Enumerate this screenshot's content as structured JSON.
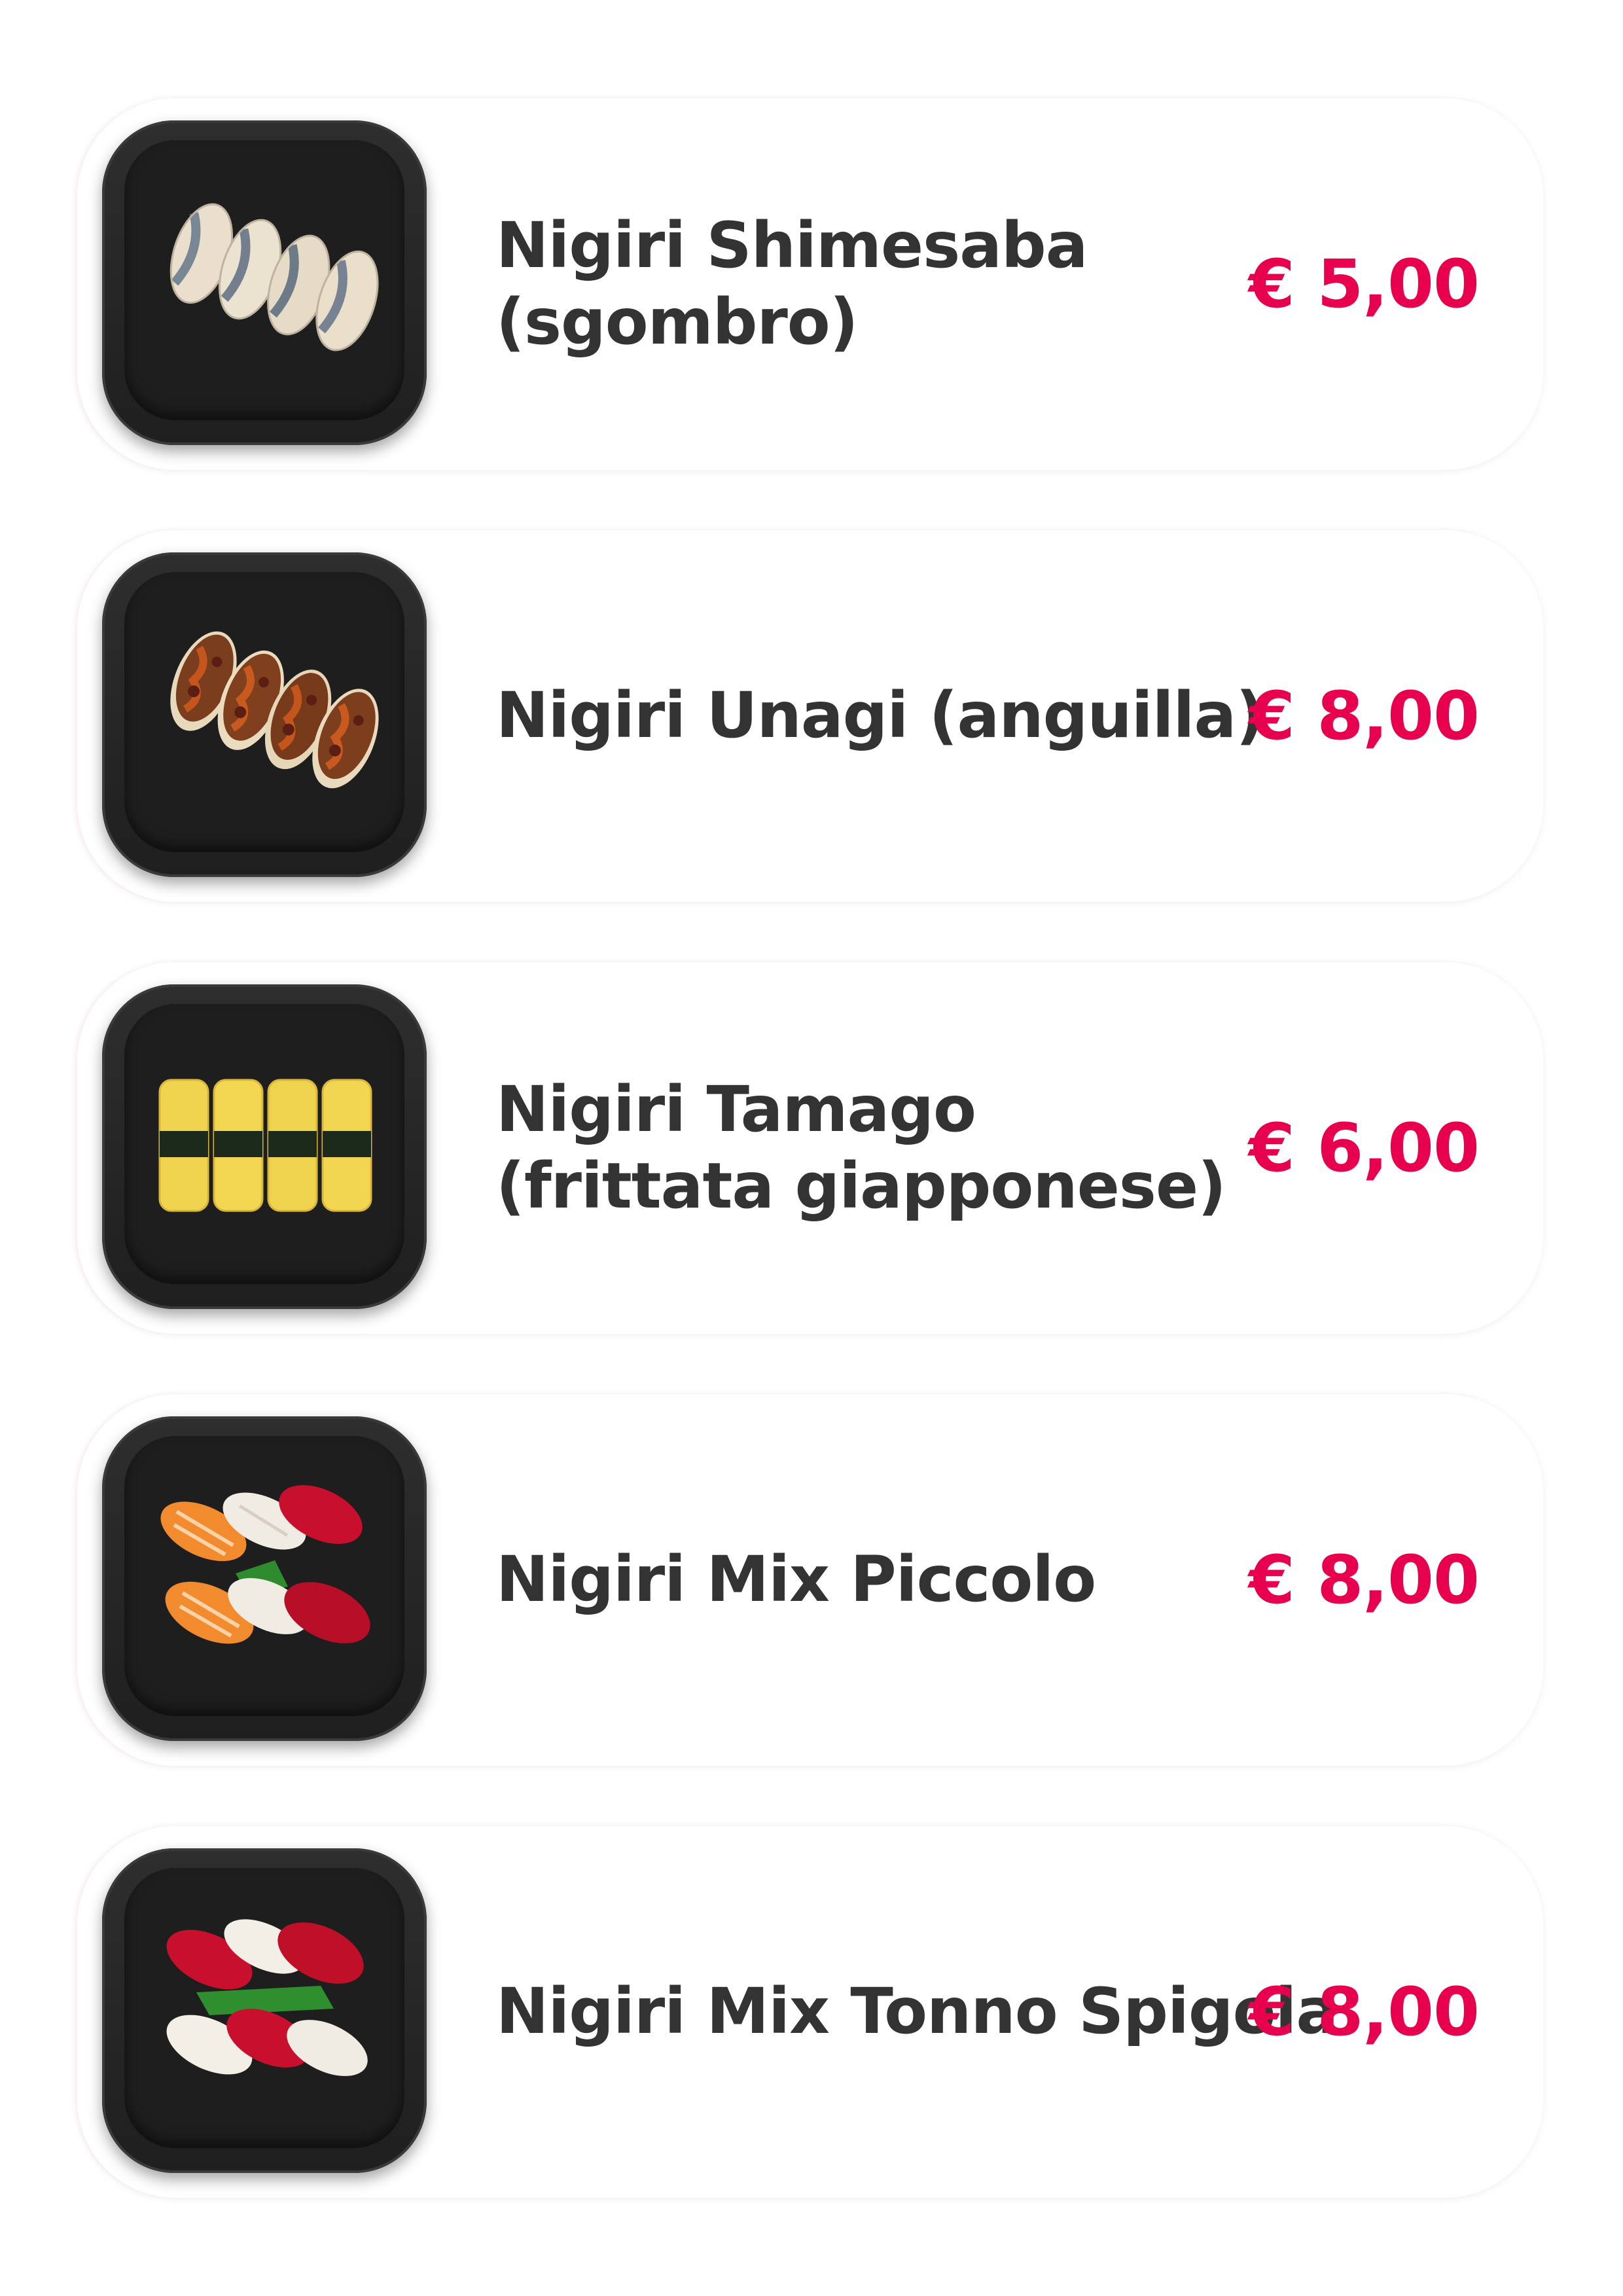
{
  "menu": {
    "accent_color": "#e6004e",
    "text_color": "#333333",
    "items": [
      {
        "name": "Nigiri Shimesaba (sgombro)",
        "line1": "Nigiri Shimesaba",
        "line2": "(sgombro)",
        "price": "€ 5,00",
        "image_icon": "mackerel-nigiri-image"
      },
      {
        "name": "Nigiri Unagi (anguilla)",
        "line1": "Nigiri Unagi (anguilla)",
        "line2": "",
        "price": "€ 8,00",
        "image_icon": "eel-nigiri-image"
      },
      {
        "name": "Nigiri Tamago (frittata giapponese)",
        "line1": "Nigiri Tamago",
        "line2": "(frittata giapponese)",
        "price": "€ 6,00",
        "image_icon": "tamago-nigiri-image"
      },
      {
        "name": "Nigiri Mix Piccolo",
        "line1": "Nigiri Mix Piccolo",
        "line2": "",
        "price": "€ 8,00",
        "image_icon": "mixed-nigiri-image"
      },
      {
        "name": "Nigiri Mix Tonno Spigola",
        "line1": "Nigiri Mix Tonno Spigola",
        "line2": "",
        "price": "€ 8,00",
        "image_icon": "tuna-seabass-nigiri-image"
      }
    ]
  }
}
